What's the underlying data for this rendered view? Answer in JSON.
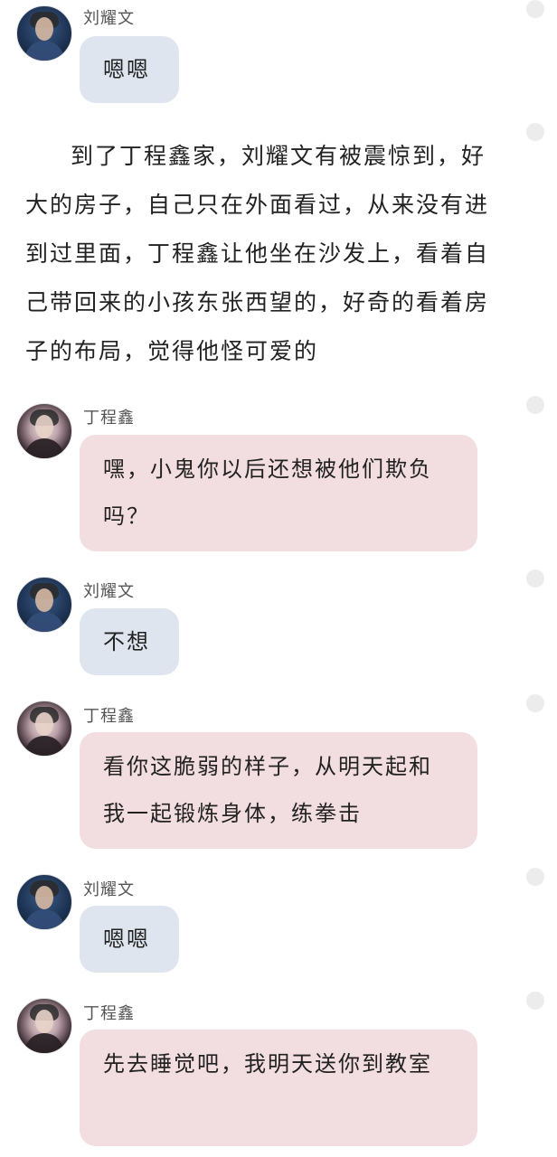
{
  "messages": [
    {
      "speaker": "刘耀文",
      "text": "嗯嗯"
    },
    {
      "speaker": "丁程鑫",
      "text": "嘿，小鬼你以后还想被他们欺负吗？"
    },
    {
      "speaker": "刘耀文",
      "text": "不想"
    },
    {
      "speaker": "丁程鑫",
      "text": "看你这脆弱的样子，从明天起和我一起锻炼身体，练拳击"
    },
    {
      "speaker": "刘耀文",
      "text": "嗯嗯"
    },
    {
      "speaker": "丁程鑫",
      "text": "先去睡觉吧，我明天送你到教室"
    }
  ],
  "narration": "到了丁程鑫家，刘耀文有被震惊到，好大的房子，自己只在外面看过，从来没有进到过里面，丁程鑫让他坐在沙发上，看着自己带回来的小孩东张西望的，好奇的看着房子的布局，觉得他怪可爱的",
  "colors": {
    "blue_bubble": "#dee5ee",
    "pink_bubble": "#f2dde0",
    "dot": "#ececec"
  }
}
